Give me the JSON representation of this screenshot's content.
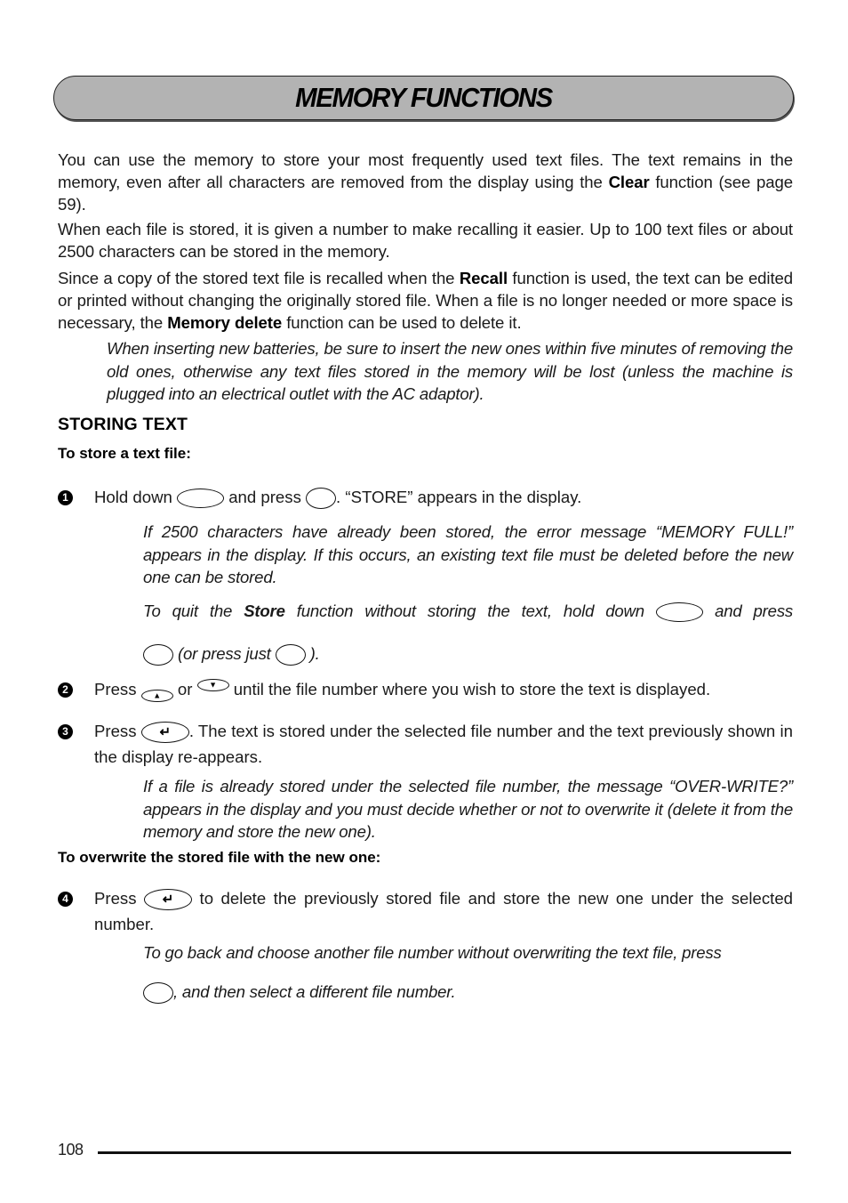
{
  "page": {
    "title": "MEMORY FUNCTIONS",
    "page_number": "108"
  },
  "intro": {
    "p1_a": "You can use the memory to store your most frequently used text files. The text remains in the memory, even after all characters are removed from the display using the ",
    "p1_bold": "Clear",
    "p1_b": " function (see page 59).",
    "p2": "When each file is stored, it is given a number to make recalling it easier. Up to 100 text files or about 2500 characters can be stored in the memory.",
    "p3_a": "Since a copy of the stored text file is recalled when the ",
    "p3_bold1": "Recall",
    "p3_b": " function is used, the text can be edited or printed without changing the originally stored file. When a file is no longer needed or more space is necessary, the ",
    "p3_bold2": "Memory delete",
    "p3_c": " function can be used to delete it.",
    "note": "When inserting new batteries, be sure to insert the new ones within five minutes of removing the old ones, otherwise any text files stored in the memory will be lost (unless the machine is plugged into an electrical outlet with the AC adaptor)."
  },
  "section": {
    "heading": "STORING TEXT",
    "subheading1": "To store a text file:",
    "subheading2": "To overwrite the stored file with the new one:"
  },
  "steps": [
    {
      "number": "1",
      "text_a": "Hold down",
      "text_b": "and press",
      "text_c": ". “STORE” appears in the display.",
      "note1": "If 2500 characters have already been stored, the error message “MEMORY FULL!” appears in the display. If this occurs, an existing text file must be deleted before the new one can be stored.",
      "note2_a": "To quit the ",
      "note2_bold": "Store",
      "note2_b": " function without storing the text, hold down",
      "note2_c": "and press",
      "note2_d": "(or press just",
      "note2_e": ")."
    },
    {
      "number": "2",
      "text_a": "Press",
      "text_b": "or",
      "text_c": "until the file number where you wish to store the text is displayed."
    },
    {
      "number": "3",
      "text_a": "Press",
      "text_b": ". The text is stored under the selected file number and the text previously shown in the display re-appears.",
      "note": "If a file is already stored under the selected file number, the message “OVER-WRITE?” appears in the display and you must decide whether or not to overwrite it (delete it from the memory and store the new one)."
    },
    {
      "number": "4",
      "text_a": "Press",
      "text_b": "to delete the previously stored file and store the new one under the selected number.",
      "note_a": "To go back and choose another file number without overwriting the text file, press",
      "note_b": ", and then select a different file number."
    }
  ],
  "icons": {
    "up_arrow": "▲",
    "down_arrow": "▼",
    "enter": "↵"
  }
}
